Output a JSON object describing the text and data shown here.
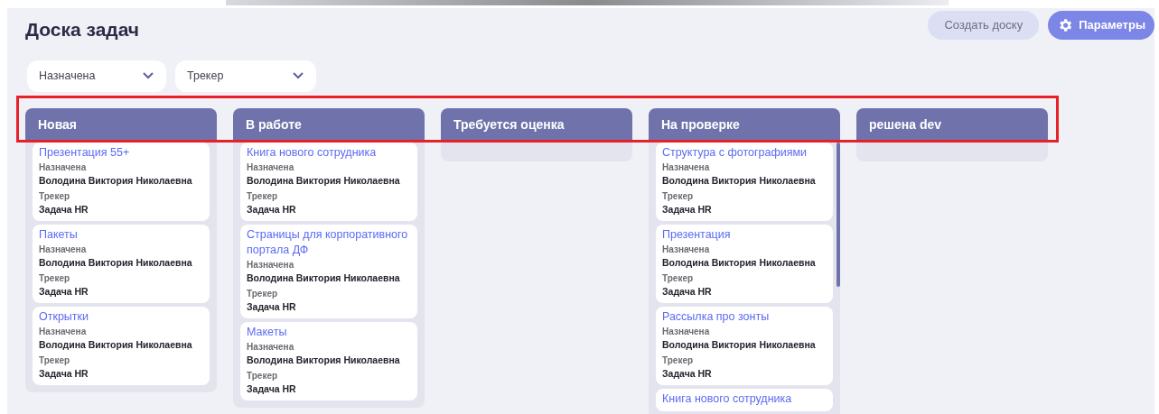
{
  "title": "Доска задач",
  "buttons": [
    {
      "kind": "secondary",
      "label": "Создать доску"
    },
    {
      "kind": "primary",
      "label": "Параметры"
    }
  ],
  "filters": [
    {
      "placeholder": "Назначена"
    },
    {
      "placeholder": "Трекер"
    }
  ],
  "columns": [
    {
      "title": "Новая",
      "cards": [
        {
          "title": "Презентация 55+",
          "assignee_label": "Назначена",
          "assignee": "Володина Виктория Николаевна",
          "tracker_label": "Трекер",
          "tracker": "Задача HR"
        },
        {
          "title": "Пакеты",
          "assignee_label": "Назначена",
          "assignee": "Володина Виктория Николаевна",
          "tracker_label": "Трекер",
          "tracker": "Задача HR"
        },
        {
          "title": "Открытки",
          "assignee_label": "Назначена",
          "assignee": "Володина Виктория Николаевна",
          "tracker_label": "Трекер",
          "tracker": "Задача HR"
        }
      ]
    },
    {
      "title": "В работе",
      "cards": [
        {
          "title": "Книга нового сотрудника",
          "assignee_label": "Назначена",
          "assignee": "Володина Виктория Николаевна",
          "tracker_label": "Трекер",
          "tracker": "Задача HR"
        },
        {
          "title": "Страницы для корпоративного портала ДФ",
          "assignee_label": "Назначена",
          "assignee": "Володина Виктория Николаевна",
          "tracker_label": "Трекер",
          "tracker": "Задача HR"
        },
        {
          "title": "Макеты",
          "assignee_label": "Назначена",
          "assignee": "Володина Виктория Николаевна",
          "tracker_label": "Трекер",
          "tracker": "Задача HR"
        }
      ]
    },
    {
      "title": "Требуется оценка"
    },
    {
      "title": "На проверке",
      "scrollable": true,
      "cards": [
        {
          "title": "Структура с фотографиями",
          "assignee_label": "Назначена",
          "assignee": "Володина Виктория Николаевна",
          "tracker_label": "Трекер",
          "tracker": "Задача HR"
        },
        {
          "title": "Презентация",
          "assignee_label": "Назначена",
          "assignee": "Володина Виктория Николаевна",
          "tracker_label": "Трекер",
          "tracker": "Задача HR"
        },
        {
          "title": "Рассылка про зонты",
          "assignee_label": "Назначена",
          "assignee": "Володина Виктория Николаевна",
          "tracker_label": "Трекер",
          "tracker": "Задача HR"
        },
        {
          "title": "Книга нового сотрудника"
        }
      ]
    },
    {
      "title": "решена dev"
    }
  ]
}
